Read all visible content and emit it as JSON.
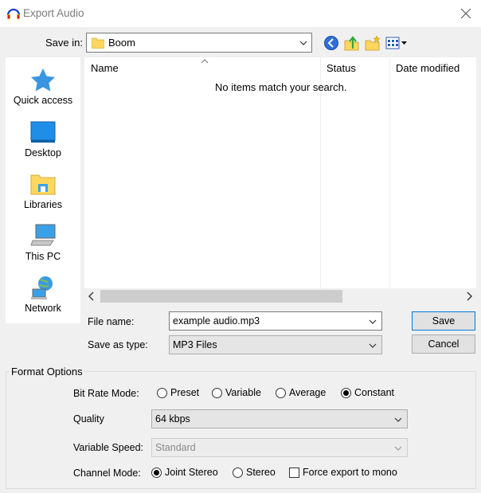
{
  "window": {
    "title": "Export Audio"
  },
  "save_in": {
    "label": "Save in:",
    "value": "Boom"
  },
  "places": [
    {
      "name": "quick-access",
      "label": "Quick access",
      "icon": "star-icon"
    },
    {
      "name": "desktop",
      "label": "Desktop",
      "icon": "desktop-icon"
    },
    {
      "name": "libraries",
      "label": "Libraries",
      "icon": "libraries-icon"
    },
    {
      "name": "this-pc",
      "label": "This PC",
      "icon": "computer-icon"
    },
    {
      "name": "network",
      "label": "Network",
      "icon": "network-icon"
    }
  ],
  "file_list": {
    "columns": [
      "Name",
      "Status",
      "Date modified"
    ],
    "empty_message": "No items match your search."
  },
  "file_name": {
    "label": "File name:",
    "value": "example audio.mp3"
  },
  "save_as_type": {
    "label": "Save as type:",
    "value": "MP3 Files"
  },
  "buttons": {
    "save": "Save",
    "cancel": "Cancel"
  },
  "format_options": {
    "title": "Format Options",
    "bit_rate_mode": {
      "label": "Bit Rate Mode:",
      "options": [
        "Preset",
        "Variable",
        "Average",
        "Constant"
      ],
      "selected": "Constant"
    },
    "quality": {
      "label": "Quality",
      "value": "64 kbps"
    },
    "variable_speed": {
      "label": "Variable Speed:",
      "value": "Standard"
    },
    "channel_mode": {
      "label": "Channel Mode:",
      "options": [
        "Joint Stereo",
        "Stereo"
      ],
      "selected": "Joint Stereo",
      "force_mono_label": "Force export to mono",
      "force_mono_checked": false
    }
  },
  "colors": {
    "accent": "#0078d7",
    "folder": "#ffd75e"
  }
}
